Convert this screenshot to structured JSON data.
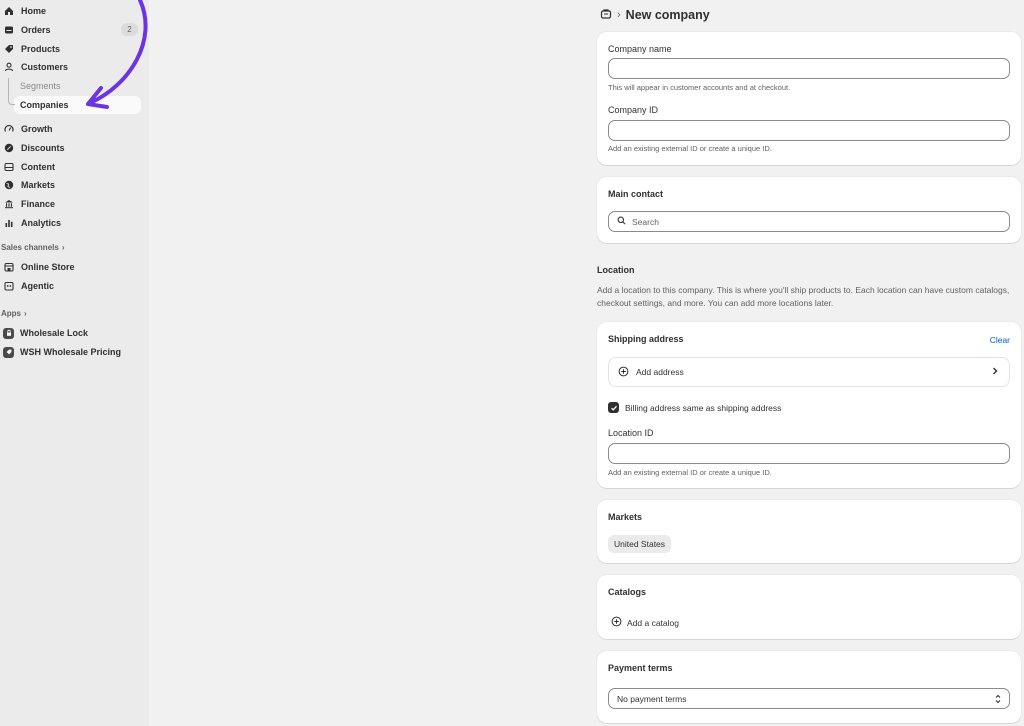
{
  "sidebar": {
    "nav": [
      {
        "label": "Home",
        "icon": "home-icon"
      },
      {
        "label": "Orders",
        "icon": "orders-icon",
        "badge": "2"
      },
      {
        "label": "Products",
        "icon": "tag-icon"
      },
      {
        "label": "Customers",
        "icon": "person-icon"
      }
    ],
    "customers_sub": {
      "segments": "Segments",
      "companies": "Companies"
    },
    "nav2": [
      {
        "label": "Growth",
        "icon": "gauge-icon"
      },
      {
        "label": "Discounts",
        "icon": "discount-icon"
      },
      {
        "label": "Content",
        "icon": "content-icon"
      },
      {
        "label": "Markets",
        "icon": "globe-icon"
      },
      {
        "label": "Finance",
        "icon": "bank-icon"
      },
      {
        "label": "Analytics",
        "icon": "bar-chart-icon"
      }
    ],
    "sales_channels_label": "Sales channels",
    "channels": [
      {
        "label": "Online Store",
        "icon": "store-icon"
      },
      {
        "label": "Agentic",
        "icon": "agentic-icon"
      }
    ],
    "apps_label": "Apps",
    "apps": [
      {
        "label": "Wholesale Lock",
        "icon": "app-icon"
      },
      {
        "label": "WSH Wholesale Pricing",
        "icon": "app-icon"
      }
    ]
  },
  "header": {
    "title": "New company",
    "icon": "company-icon"
  },
  "company_card": {
    "name_label": "Company name",
    "name_help": "This will appear in customer accounts and at checkout.",
    "id_label": "Company ID",
    "id_help": "Add an existing external ID or create a unique ID."
  },
  "contact_card": {
    "title": "Main contact",
    "search_placeholder": "Search"
  },
  "location": {
    "title": "Location",
    "description": "Add a location to this company. This is where you'll ship products to. Each location can have custom catalogs, checkout settings, and more. You can add more locations later."
  },
  "shipping_card": {
    "title": "Shipping address",
    "clear": "Clear",
    "add_address": "Add address",
    "billing_same": "Billing address same as shipping address",
    "billing_checked": true,
    "location_id_label": "Location ID",
    "location_id_help": "Add an existing external ID or create a unique ID."
  },
  "markets_card": {
    "title": "Markets",
    "tag": "United States"
  },
  "catalogs_card": {
    "title": "Catalogs",
    "add": "Add a catalog"
  },
  "payment_card": {
    "title": "Payment terms",
    "selected": "No payment terms"
  },
  "colors": {
    "accent_arrow": "#6a35e0",
    "link": "#005bd3"
  }
}
